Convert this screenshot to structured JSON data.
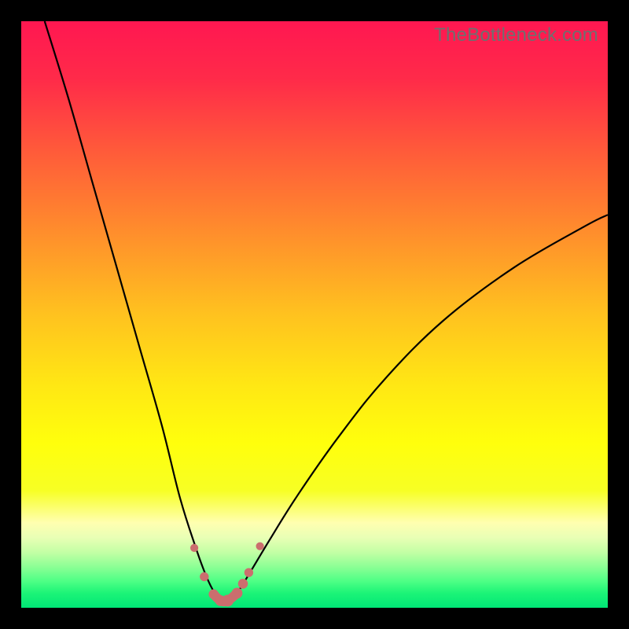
{
  "watermark": "TheBottleneck.com",
  "colors": {
    "bg_black": "#000000",
    "marker": "#cb6e6e",
    "curve": "#000000"
  },
  "gradient_stops": [
    {
      "offset": 0.0,
      "color": "#ff1751"
    },
    {
      "offset": 0.1,
      "color": "#ff2b49"
    },
    {
      "offset": 0.22,
      "color": "#ff5a3a"
    },
    {
      "offset": 0.35,
      "color": "#ff8a2d"
    },
    {
      "offset": 0.5,
      "color": "#ffc21f"
    },
    {
      "offset": 0.62,
      "color": "#ffe714"
    },
    {
      "offset": 0.72,
      "color": "#ffff0c"
    },
    {
      "offset": 0.8,
      "color": "#f7ff24"
    },
    {
      "offset": 0.855,
      "color": "#ffffb0"
    },
    {
      "offset": 0.88,
      "color": "#e9ffb5"
    },
    {
      "offset": 0.905,
      "color": "#c4ffa5"
    },
    {
      "offset": 0.93,
      "color": "#8cff95"
    },
    {
      "offset": 0.955,
      "color": "#4dff85"
    },
    {
      "offset": 0.975,
      "color": "#1cf477"
    },
    {
      "offset": 1.0,
      "color": "#00e676"
    }
  ],
  "chart_data": {
    "type": "line",
    "title": "",
    "xlabel": "",
    "ylabel": "",
    "xlim": [
      0,
      100
    ],
    "ylim": [
      0,
      100
    ],
    "annotations": [
      "TheBottleneck.com"
    ],
    "series": [
      {
        "name": "left-curve",
        "x": [
          4,
          8,
          12,
          16,
          20,
          24,
          27,
          29.5,
          31.5,
          33,
          34.5
        ],
        "y": [
          100,
          87,
          73,
          59,
          45,
          31,
          19,
          11,
          5.5,
          2.5,
          1
        ]
      },
      {
        "name": "right-curve",
        "x": [
          35.5,
          37,
          39,
          42,
          47,
          54,
          62,
          72,
          84,
          96,
          100
        ],
        "y": [
          1.2,
          2.8,
          6,
          11,
          19,
          29,
          39,
          49,
          58,
          65,
          67
        ]
      },
      {
        "name": "bottom-markers",
        "x": [
          29.5,
          31.2,
          32.8,
          34.0,
          35.2,
          36.8,
          37.8,
          38.8,
          40.7
        ],
        "y": [
          10.2,
          5.3,
          2.3,
          1.2,
          1.2,
          2.5,
          4.1,
          6.0,
          10.5
        ]
      }
    ]
  }
}
